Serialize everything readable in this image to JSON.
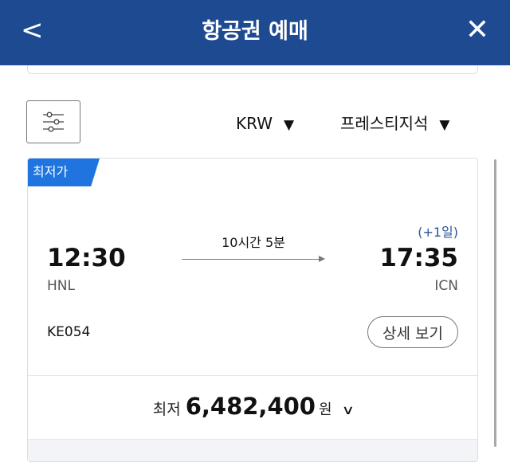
{
  "header": {
    "back_icon": "<",
    "title": "항공권 예매",
    "close_icon": "✕",
    "background_color": "#1e4a91"
  },
  "toolbar": {
    "filter_icon": "sliders-icon",
    "currency": "KRW",
    "cabin_class": "프레스티지석",
    "dropdown_caret": "▼"
  },
  "flight_card": {
    "badge": "최저가",
    "badge_color": "#1f74e0",
    "departure": {
      "time": "12:30",
      "airport": "HNL"
    },
    "arrival": {
      "time": "17:35",
      "airport": "ICN",
      "day_offset": "(+1일)"
    },
    "duration": "10시간 5분",
    "flight_number": "KE054",
    "detail_button": "상세 보기",
    "price": {
      "label": "최저",
      "amount": "6,482,400",
      "unit": "원",
      "expand_icon": "∨"
    }
  }
}
